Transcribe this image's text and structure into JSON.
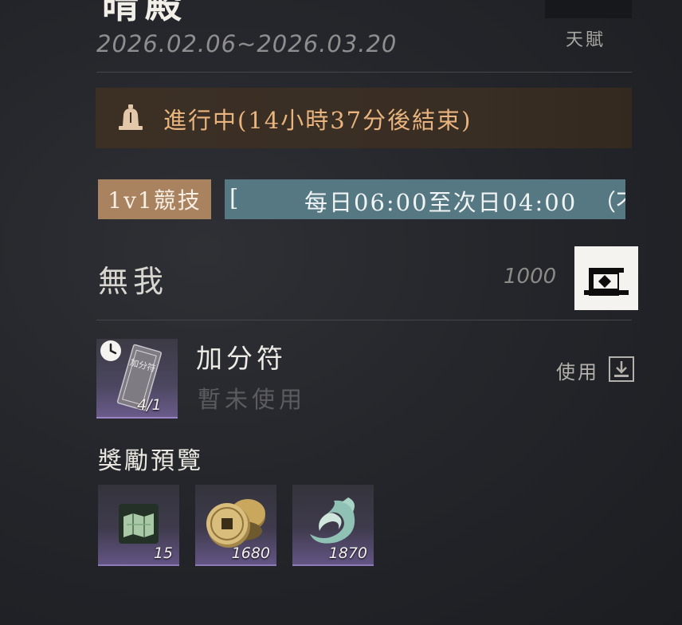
{
  "header": {
    "title_partial": "晴殿",
    "date_range": "2026.02.06~2026.03.20",
    "talent_label": "天賦"
  },
  "status": {
    "icon": "bell-icon",
    "text": "進行中(14小時37分後結束)",
    "color": "#e9b47d"
  },
  "mode": {
    "tag": "1v1競技",
    "schedule_lead": "[",
    "schedule_text": "每日06:00至次日04:00",
    "schedule_tail": "（不"
  },
  "rank": {
    "name": "無我",
    "score": "1000",
    "badge_icon": "rank-badge-icon"
  },
  "item": {
    "name": "加分符",
    "status": "暫未使用",
    "count": "4/1",
    "card_text": "加分符",
    "use_label": "使用",
    "icons": [
      "clock-icon",
      "talisman-icon",
      "import-icon"
    ]
  },
  "rewards": {
    "heading": "獎勵預覽",
    "items": [
      {
        "icon": "map-scroll-icon",
        "qty": "15"
      },
      {
        "icon": "copper-coins-icon",
        "qty": "1680"
      },
      {
        "icon": "jade-swirl-icon",
        "qty": "1870"
      }
    ]
  },
  "colors": {
    "accent": "#e9b47d",
    "mode_tag_bg": "#a9825f",
    "schedule_bg": "#557882",
    "tile_rarity": "#9a84c6"
  }
}
